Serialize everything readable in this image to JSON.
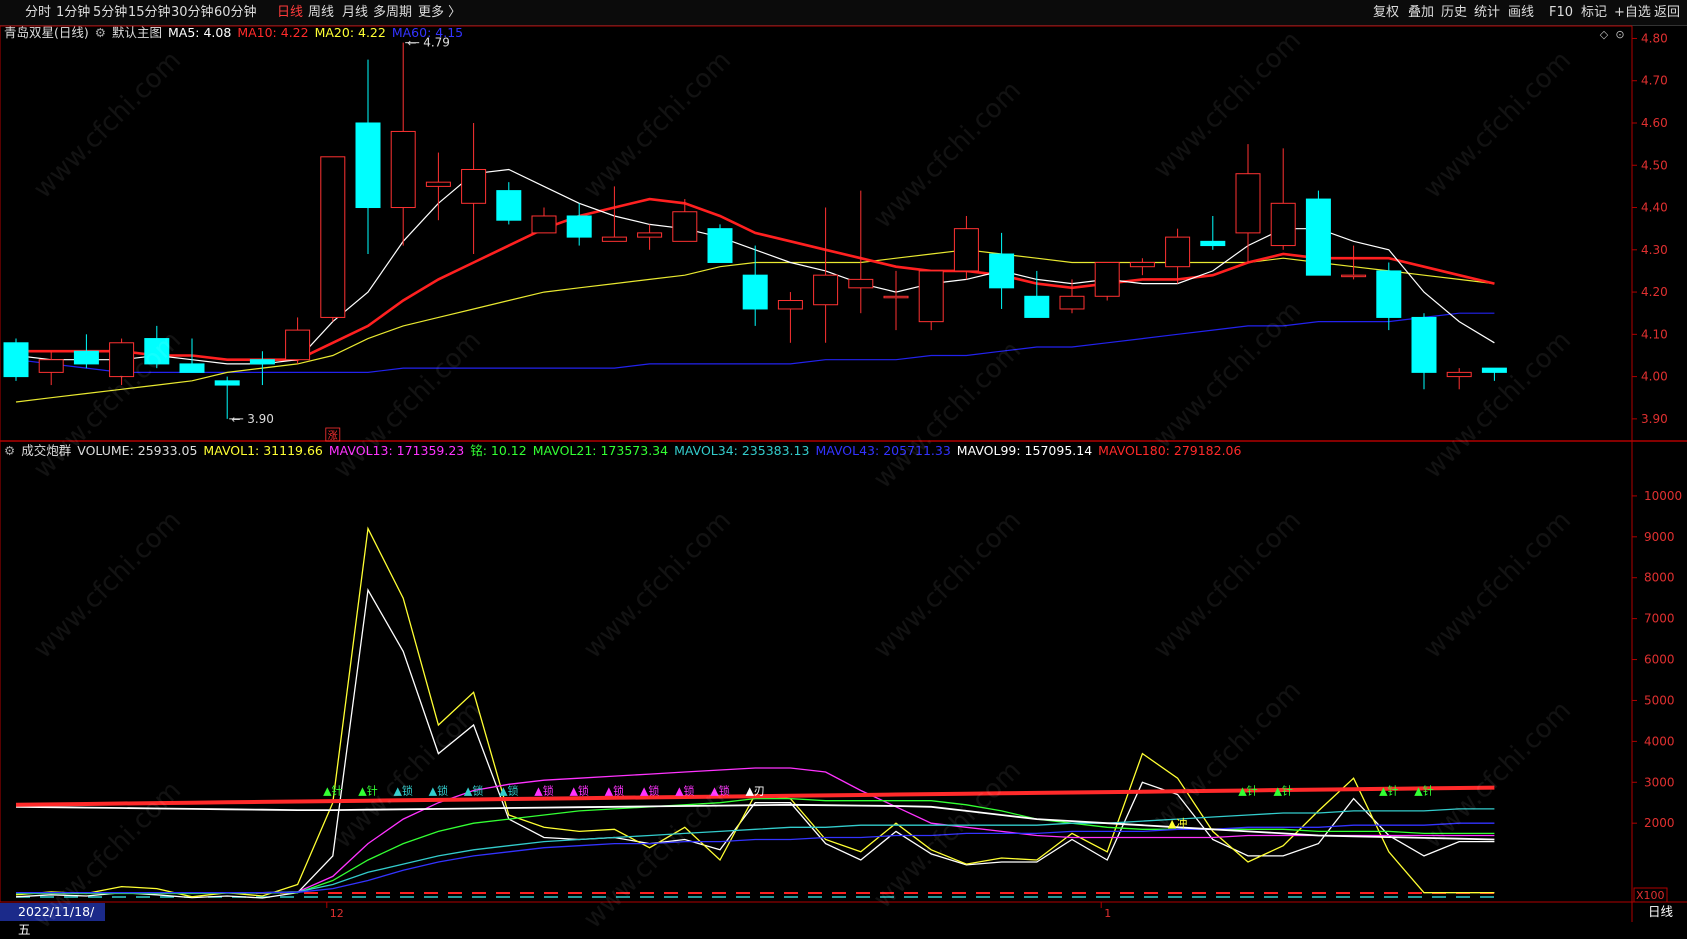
{
  "toolbar": {
    "left": [
      "分时",
      "1分钟",
      "5分钟",
      "15分钟",
      "30分钟",
      "60分钟",
      "日线",
      "周线",
      "月线",
      "多周期",
      "更多 〉"
    ],
    "active_index": 6,
    "right": [
      "复权",
      "叠加",
      "历史",
      "统计",
      "画线",
      "F10",
      "标记",
      "+自选",
      "返回"
    ]
  },
  "main_header": {
    "stock": "青岛双星(日线)",
    "icon": "settings-icon",
    "template": "默认主图",
    "indicators": [
      {
        "label": "MA5: 4.08",
        "color": "#ffffff"
      },
      {
        "label": "MA10: 4.22",
        "color": "#ff2a2a"
      },
      {
        "label": "MA20: 4.22",
        "color": "#ffff33"
      },
      {
        "label": "MA60: 4.15",
        "color": "#3333ff"
      }
    ]
  },
  "sub_header": {
    "icon": "settings-icon",
    "indicators": [
      {
        "label": "成交炮群",
        "color": "#dddddd"
      },
      {
        "label": "VOLUME: 25933.05",
        "color": "#dddddd"
      },
      {
        "label": "MAVOL1: 31119.66",
        "color": "#ffff33"
      },
      {
        "label": "MAVOL13: 171359.23",
        "color": "#ff33ff"
      },
      {
        "label": "铭: 10.12",
        "color": "#33ff33"
      },
      {
        "label": "MAVOL21: 173573.34",
        "color": "#33ff33"
      },
      {
        "label": "MAVOL34: 235383.13",
        "color": "#33cccc"
      },
      {
        "label": "MAVOL43: 205711.33",
        "color": "#3333ff"
      },
      {
        "label": "MAVOL99: 157095.14",
        "color": "#ffffff"
      },
      {
        "label": "MAVOL180: 279182.06",
        "color": "#ff2a2a"
      }
    ]
  },
  "chart_data": [
    {
      "type": "candlestick",
      "ylim": [
        3.85,
        4.82
      ],
      "y_ticks": [
        "4.80",
        "4.70",
        "4.60",
        "4.50",
        "4.40",
        "4.30",
        "4.20",
        "4.10",
        "4.00",
        "3.90"
      ],
      "ohlc": [
        [
          4.08,
          4.09,
          3.99,
          4.0
        ],
        [
          4.01,
          4.06,
          3.98,
          4.04
        ],
        [
          4.06,
          4.1,
          4.02,
          4.03
        ],
        [
          4.0,
          4.09,
          3.98,
          4.08
        ],
        [
          4.09,
          4.12,
          4.02,
          4.03
        ],
        [
          4.03,
          4.09,
          4.01,
          4.01
        ],
        [
          3.99,
          4.0,
          3.9,
          3.98
        ],
        [
          4.04,
          4.06,
          3.98,
          4.03
        ],
        [
          4.04,
          4.14,
          4.03,
          4.11
        ],
        [
          4.14,
          4.52,
          4.13,
          4.52
        ],
        [
          4.6,
          4.75,
          4.29,
          4.4
        ],
        [
          4.4,
          4.79,
          4.31,
          4.58
        ],
        [
          4.45,
          4.53,
          4.37,
          4.46
        ],
        [
          4.41,
          4.6,
          4.29,
          4.49
        ],
        [
          4.44,
          4.46,
          4.36,
          4.37
        ],
        [
          4.34,
          4.4,
          4.34,
          4.38
        ],
        [
          4.38,
          4.41,
          4.31,
          4.33
        ],
        [
          4.32,
          4.45,
          4.32,
          4.33
        ],
        [
          4.33,
          4.36,
          4.3,
          4.34
        ],
        [
          4.32,
          4.42,
          4.32,
          4.39
        ],
        [
          4.35,
          4.36,
          4.27,
          4.27
        ],
        [
          4.24,
          4.31,
          4.12,
          4.16
        ],
        [
          4.16,
          4.2,
          4.08,
          4.18
        ],
        [
          4.17,
          4.4,
          4.08,
          4.24
        ],
        [
          4.21,
          4.44,
          4.15,
          4.23
        ],
        [
          4.19,
          4.25,
          4.11,
          4.19
        ],
        [
          4.13,
          4.25,
          4.11,
          4.25
        ],
        [
          4.25,
          4.38,
          4.23,
          4.35
        ],
        [
          4.29,
          4.34,
          4.16,
          4.21
        ],
        [
          4.19,
          4.25,
          4.14,
          4.14
        ],
        [
          4.16,
          4.23,
          4.15,
          4.19
        ],
        [
          4.19,
          4.27,
          4.18,
          4.27
        ],
        [
          4.26,
          4.28,
          4.24,
          4.27
        ],
        [
          4.26,
          4.35,
          4.22,
          4.33
        ],
        [
          4.32,
          4.38,
          4.3,
          4.31
        ],
        [
          4.34,
          4.55,
          4.27,
          4.48
        ],
        [
          4.31,
          4.54,
          4.3,
          4.41
        ],
        [
          4.42,
          4.44,
          4.24,
          4.24
        ],
        [
          4.24,
          4.31,
          4.23,
          4.24
        ],
        [
          4.25,
          4.27,
          4.11,
          4.14
        ],
        [
          4.14,
          4.15,
          3.97,
          4.01
        ],
        [
          4.0,
          4.02,
          3.97,
          4.01
        ],
        [
          4.02,
          4.02,
          3.99,
          4.01
        ]
      ],
      "ma5": [
        4.05,
        4.04,
        4.04,
        4.04,
        4.05,
        4.04,
        4.03,
        4.03,
        4.04,
        4.13,
        4.2,
        4.32,
        4.41,
        4.48,
        4.49,
        4.45,
        4.41,
        4.38,
        4.36,
        4.35,
        4.33,
        4.3,
        4.27,
        4.25,
        4.22,
        4.2,
        4.22,
        4.23,
        4.25,
        4.23,
        4.22,
        4.23,
        4.22,
        4.22,
        4.25,
        4.31,
        4.35,
        4.35,
        4.32,
        4.3,
        4.2,
        4.13,
        4.08
      ],
      "ma10": [
        4.06,
        4.06,
        4.06,
        4.06,
        4.05,
        4.05,
        4.04,
        4.04,
        4.04,
        4.08,
        4.12,
        4.18,
        4.23,
        4.27,
        4.31,
        4.35,
        4.38,
        4.4,
        4.42,
        4.41,
        4.38,
        4.34,
        4.32,
        4.3,
        4.28,
        4.26,
        4.25,
        4.25,
        4.24,
        4.22,
        4.21,
        4.22,
        4.23,
        4.23,
        4.24,
        4.27,
        4.29,
        4.28,
        4.28,
        4.28,
        4.26,
        4.24,
        4.22
      ],
      "ma20": [
        3.94,
        3.95,
        3.96,
        3.97,
        3.98,
        3.99,
        4.01,
        4.02,
        4.03,
        4.05,
        4.09,
        4.12,
        4.14,
        4.16,
        4.18,
        4.2,
        4.21,
        4.22,
        4.23,
        4.24,
        4.26,
        4.27,
        4.27,
        4.27,
        4.27,
        4.28,
        4.29,
        4.3,
        4.29,
        4.28,
        4.27,
        4.27,
        4.27,
        4.27,
        4.27,
        4.27,
        4.28,
        4.27,
        4.26,
        4.25,
        4.24,
        4.23,
        4.22
      ],
      "ma60": [
        4.04,
        4.03,
        4.02,
        4.01,
        4.01,
        4.01,
        4.01,
        4.01,
        4.01,
        4.01,
        4.01,
        4.02,
        4.02,
        4.02,
        4.02,
        4.02,
        4.02,
        4.02,
        4.03,
        4.03,
        4.03,
        4.03,
        4.03,
        4.04,
        4.04,
        4.04,
        4.05,
        4.05,
        4.06,
        4.07,
        4.07,
        4.08,
        4.09,
        4.1,
        4.11,
        4.12,
        4.12,
        4.13,
        4.13,
        4.13,
        4.14,
        4.15,
        4.15
      ],
      "annotations": [
        {
          "index": 11,
          "value": 4.79,
          "text": "4.79"
        },
        {
          "index": 6,
          "value": 3.9,
          "text": "3.90"
        }
      ],
      "marker": {
        "index": 9,
        "text": "涨"
      }
    },
    {
      "type": "line",
      "ylim": [
        0,
        11000
      ],
      "y_ticks": [
        "10000",
        "9000",
        "8000",
        "7000",
        "6000",
        "5000",
        "4000",
        "3000",
        "2000"
      ],
      "unit_label": "X100",
      "series": [
        {
          "name": "VOLUME",
          "color": "#ffffff",
          "values": [
            200,
            250,
            220,
            300,
            250,
            180,
            220,
            170,
            300,
            1200,
            7700,
            6200,
            3700,
            4400,
            2100,
            1650,
            1600,
            1650,
            1500,
            1600,
            1350,
            2500,
            2500,
            1500,
            1100,
            1800,
            1250,
            980,
            1050,
            1050,
            1600,
            1100,
            3000,
            2700,
            1600,
            1200,
            1200,
            1500,
            2600,
            1700,
            1200,
            1550,
            1550
          ]
        },
        {
          "name": "MAVOL1",
          "color": "#ffff33",
          "values": [
            250,
            320,
            280,
            450,
            400,
            200,
            300,
            220,
            500,
            2500,
            9200,
            7500,
            4400,
            5200,
            2200,
            1900,
            1800,
            1850,
            1400,
            1900,
            1100,
            2700,
            2600,
            1600,
            1300,
            2000,
            1350,
            1000,
            1150,
            1100,
            1750,
            1300,
            3700,
            3100,
            1800,
            1050,
            1450,
            2300,
            3100,
            1300,
            300,
            300,
            300
          ]
        },
        {
          "name": "MAVOL13",
          "color": "#ff33ff",
          "values": [
            300,
            300,
            300,
            300,
            300,
            300,
            300,
            300,
            320,
            700,
            1500,
            2100,
            2500,
            2800,
            2950,
            3050,
            3100,
            3150,
            3200,
            3250,
            3300,
            3350,
            3350,
            3250,
            2800,
            2400,
            2000,
            1900,
            1800,
            1700,
            1650,
            1650,
            1650,
            1650,
            1650,
            1700,
            1700,
            1700,
            1700,
            1700,
            1700,
            1700,
            1700
          ]
        },
        {
          "name": "MAVOL21",
          "color": "#33ff33",
          "values": [
            280,
            280,
            280,
            280,
            280,
            280,
            290,
            290,
            300,
            600,
            1100,
            1500,
            1800,
            2000,
            2100,
            2200,
            2300,
            2350,
            2400,
            2450,
            2500,
            2600,
            2600,
            2550,
            2550,
            2550,
            2550,
            2450,
            2300,
            2100,
            2000,
            1900,
            1850,
            1850,
            1850,
            1850,
            1850,
            1800,
            1800,
            1800,
            1750,
            1750,
            1750
          ]
        },
        {
          "name": "MAVOL34",
          "color": "#33cccc",
          "values": [
            300,
            300,
            300,
            300,
            300,
            300,
            300,
            300,
            320,
            500,
            800,
            1000,
            1200,
            1350,
            1450,
            1550,
            1600,
            1650,
            1700,
            1750,
            1800,
            1850,
            1900,
            1900,
            1950,
            1950,
            1950,
            1950,
            1950,
            1950,
            2000,
            2000,
            2050,
            2100,
            2150,
            2200,
            2250,
            2250,
            2300,
            2300,
            2300,
            2350,
            2350
          ]
        },
        {
          "name": "MAVOL43",
          "color": "#3333ff",
          "values": [
            300,
            300,
            300,
            300,
            300,
            300,
            300,
            300,
            310,
            400,
            600,
            850,
            1050,
            1200,
            1300,
            1400,
            1450,
            1500,
            1500,
            1550,
            1550,
            1600,
            1600,
            1650,
            1650,
            1700,
            1700,
            1750,
            1750,
            1750,
            1800,
            1800,
            1800,
            1850,
            1850,
            1900,
            1900,
            1900,
            1950,
            1950,
            1950,
            2000,
            2000
          ]
        },
        {
          "name": "MAVOL99",
          "color": "#ffffff",
          "values": [
            2400,
            2390,
            2380,
            2370,
            2360,
            2350,
            2340,
            2330,
            2320,
            2320,
            2330,
            2340,
            2350,
            2360,
            2370,
            2380,
            2390,
            2400,
            2410,
            2420,
            2430,
            2440,
            2450,
            2440,
            2430,
            2420,
            2400,
            2300,
            2200,
            2100,
            2050,
            2000,
            1950,
            1900,
            1850,
            1800,
            1750,
            1700,
            1680,
            1660,
            1640,
            1620,
            1600
          ]
        },
        {
          "name": "MAVOL180",
          "color": "#ff2a2a",
          "values": [
            2450,
            2460,
            2470,
            2480,
            2490,
            2500,
            2510,
            2520,
            2530,
            2540,
            2550,
            2560,
            2570,
            2580,
            2590,
            2600,
            2610,
            2620,
            2630,
            2640,
            2650,
            2660,
            2670,
            2680,
            2690,
            2700,
            2710,
            2720,
            2730,
            2740,
            2750,
            2760,
            2770,
            2780,
            2790,
            2800,
            2810,
            2820,
            2830,
            2840,
            2850,
            2860,
            2870
          ]
        }
      ],
      "signals": [
        {
          "index": 9,
          "text": "▲针",
          "color": "#33ff33"
        },
        {
          "index": 10,
          "text": "▲针",
          "color": "#33ff33"
        },
        {
          "index": 11,
          "text": "▲锁",
          "color": "#33cccc"
        },
        {
          "index": 12,
          "text": "▲锁",
          "color": "#33cccc"
        },
        {
          "index": 13,
          "text": "▲锁",
          "color": "#33cccc"
        },
        {
          "index": 14,
          "text": "▲锁",
          "color": "#33cccc"
        },
        {
          "index": 15,
          "text": "▲锁",
          "color": "#ff33ff"
        },
        {
          "index": 16,
          "text": "▲锁",
          "color": "#ff33ff"
        },
        {
          "index": 17,
          "text": "▲锁",
          "color": "#ff33ff"
        },
        {
          "index": 18,
          "text": "▲锁",
          "color": "#ff33ff"
        },
        {
          "index": 19,
          "text": "▲锁",
          "color": "#ff33ff"
        },
        {
          "index": 20,
          "text": "▲锁",
          "color": "#ff33ff"
        },
        {
          "index": 21,
          "text": "▲刃",
          "color": "#ffffff"
        },
        {
          "index": 33,
          "text": "▲冲",
          "color": "#ffff33"
        },
        {
          "index": 35,
          "text": "▲针",
          "color": "#33ff33"
        },
        {
          "index": 36,
          "text": "▲针",
          "color": "#33ff33"
        },
        {
          "index": 39,
          "text": "▲针",
          "color": "#33ff33"
        },
        {
          "index": 40,
          "text": "▲针",
          "color": "#33ff33"
        }
      ]
    }
  ],
  "x_axis": {
    "date_label": "2022/11/18/五",
    "month_ticks": [
      {
        "index": 9,
        "label": "12"
      },
      {
        "index": 31,
        "label": "1"
      }
    ]
  },
  "period_label": "日线",
  "watermark": "www.cfchi.com",
  "colors": {
    "up": "#ff3232",
    "down": "#00ffff",
    "axis": "#b00000",
    "background": "#000000"
  }
}
